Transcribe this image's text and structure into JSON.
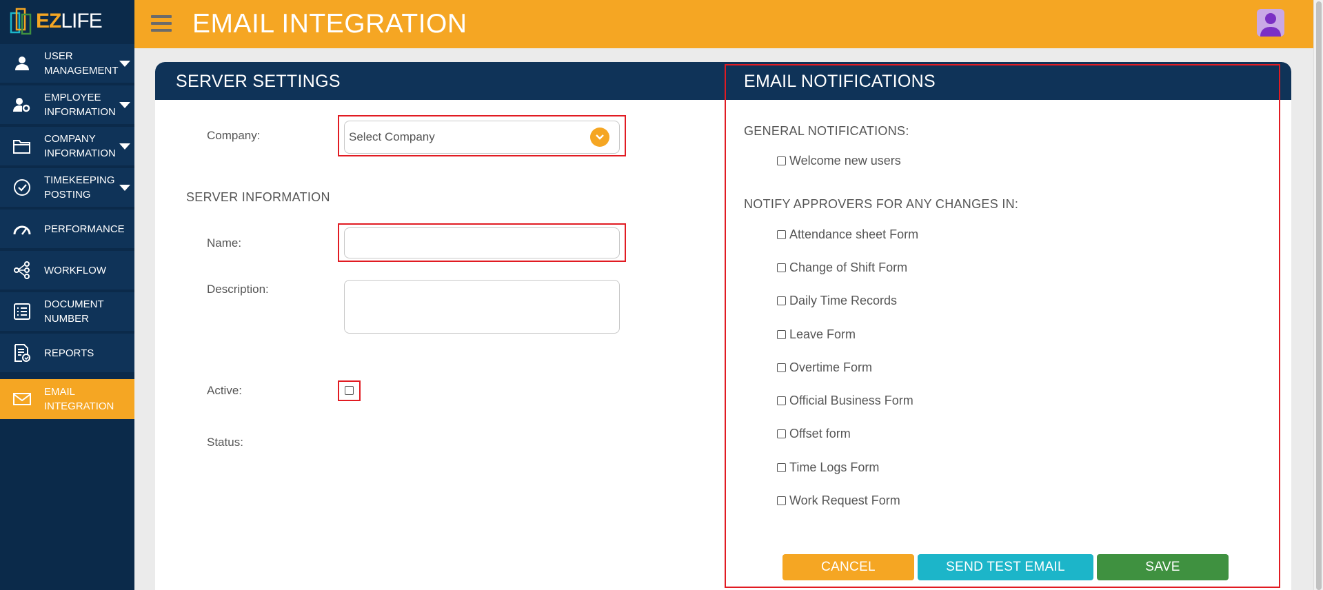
{
  "app": {
    "logo_ez": "EZ",
    "logo_life": "LIFE",
    "page_title": "EMAIL INTEGRATION"
  },
  "sidebar": {
    "items": [
      {
        "label": "USER MANAGEMENT",
        "icon": "user-icon",
        "has_caret": true
      },
      {
        "label": "EMPLOYEE INFORMATION",
        "icon": "user-settings-icon",
        "has_caret": true
      },
      {
        "label": "COMPANY INFORMATION",
        "icon": "folder-icon",
        "has_caret": true
      },
      {
        "label": "TIMEKEEPING POSTING",
        "icon": "check-circle-icon",
        "has_caret": true
      },
      {
        "label": "PERFORMANCE",
        "icon": "speedometer-icon",
        "has_caret": false
      },
      {
        "label": "WORKFLOW",
        "icon": "workflow-icon",
        "has_caret": false
      },
      {
        "label": "DOCUMENT NUMBER",
        "icon": "list-icon",
        "has_caret": false
      },
      {
        "label": "REPORTS",
        "icon": "report-icon",
        "has_caret": false
      },
      {
        "label": "EMAIL INTEGRATION",
        "icon": "mail-icon",
        "has_caret": false,
        "active": true
      }
    ]
  },
  "server_settings": {
    "title": "SERVER SETTINGS",
    "company_label": "Company:",
    "company_placeholder": "Select Company",
    "server_info_title": "SERVER INFORMATION",
    "name_label": "Name:",
    "name_value": "",
    "description_label": "Description:",
    "description_value": "",
    "active_label": "Active:",
    "status_label": "Status:"
  },
  "email_notifications": {
    "title": "EMAIL NOTIFICATIONS",
    "general_title": "GENERAL NOTIFICATIONS:",
    "general_items": [
      "Welcome new users"
    ],
    "approvers_title": "NOTIFY APPROVERS FOR ANY CHANGES IN:",
    "approver_items": [
      "Attendance sheet Form",
      "Change of Shift Form",
      "Daily Time Records",
      "Leave Form",
      "Overtime Form",
      "Official Business Form",
      "Offset form",
      "Time Logs Form",
      "Work Request Form"
    ]
  },
  "buttons": {
    "cancel": "CANCEL",
    "send_test": "SEND TEST EMAIL",
    "save": "SAVE"
  },
  "colors": {
    "accent": "#f5a623",
    "navy": "#0f3358",
    "teal": "#1cb5c9",
    "green": "#3f9140",
    "highlight": "#e11b22"
  }
}
